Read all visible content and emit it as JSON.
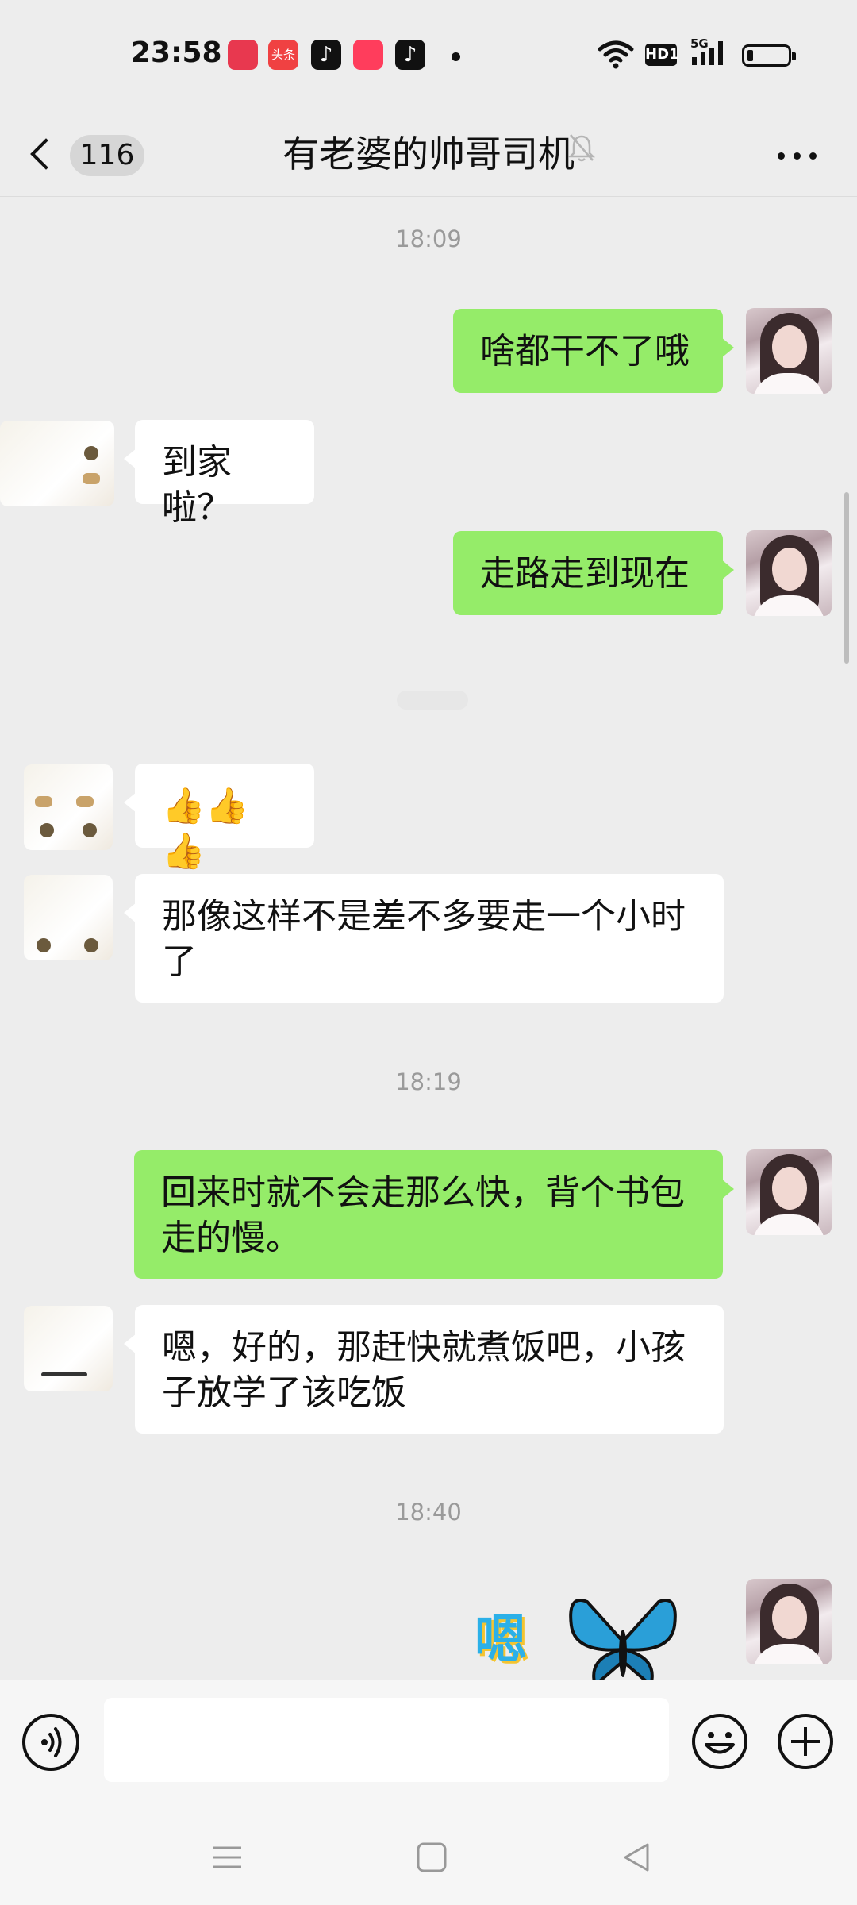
{
  "status_bar": {
    "time": "23:58",
    "notification_icons": [
      "weibo-like-icon",
      "toutiao-icon",
      "tiktok-lite-icon",
      "toutiao-video-icon",
      "tiktok-icon"
    ],
    "toutiao_label": "头条",
    "hd_label": "HD1",
    "network": "5G",
    "battery_level": 0.15
  },
  "header": {
    "unread_count": "116",
    "title": "有老婆的帅哥司机",
    "muted": true
  },
  "messages": [
    {
      "type": "time",
      "text": "18:09"
    },
    {
      "type": "outgoing",
      "text": "啥都干不了哦"
    },
    {
      "type": "incoming",
      "text": "到家啦？"
    },
    {
      "type": "outgoing",
      "text": "走路走到现在"
    },
    {
      "type": "incoming",
      "text": "👍👍👍"
    },
    {
      "type": "incoming",
      "text": "那像这样不是差不多要走一个小时了"
    },
    {
      "type": "time",
      "text": "18:19"
    },
    {
      "type": "outgoing",
      "text": "回来时就不会走那么快，背个书包走的慢。"
    },
    {
      "type": "incoming",
      "text": "嗯，好的，那赶快就煮饭吧，小孩子放学了该吃饭"
    },
    {
      "type": "time",
      "text": "18:40"
    },
    {
      "type": "outgoing-sticker",
      "text": "嗯"
    }
  ],
  "input_bar": {
    "placeholder": "",
    "value": ""
  },
  "colors": {
    "background": "#ededed",
    "outgoing_bubble": "#95ec69",
    "incoming_bubble": "#ffffff",
    "time_text": "#9a9a9a"
  }
}
